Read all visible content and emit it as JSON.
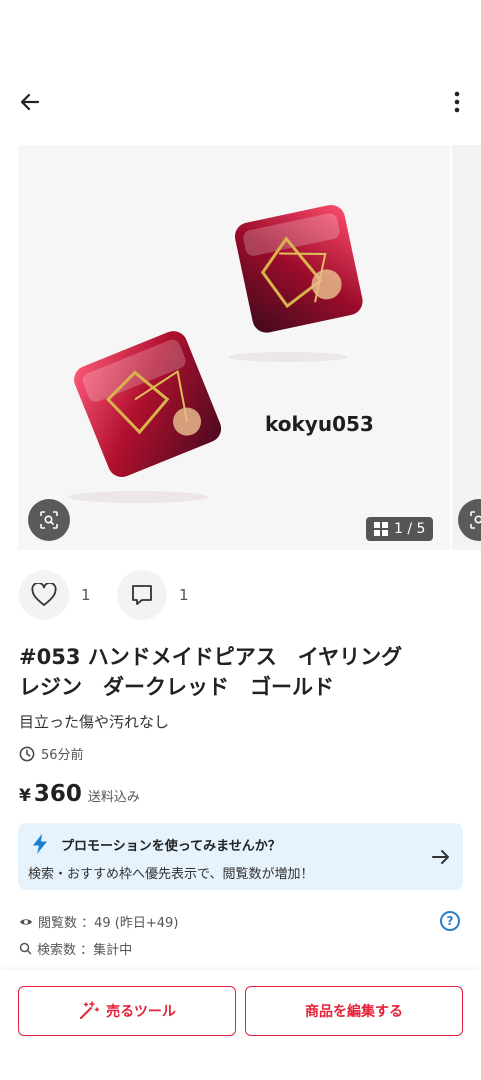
{
  "photo": {
    "watermark": "kokyu053",
    "counter": "1 / 5"
  },
  "social": {
    "likes": "1",
    "comments": "1"
  },
  "item": {
    "title": "#053 ハンドメイドピアス　イヤリング\nレジン　ダークレッド　ゴールド",
    "condition": "目立った傷や汚れなし",
    "posted": "56分前",
    "yen_symbol": "¥",
    "price": "360",
    "shipping": "送料込み"
  },
  "promo": {
    "title": "プロモーションを使ってみませんか？",
    "subtitle": "検索・おすすめ枠へ優先表示で、閲覧数が増加！"
  },
  "stats": {
    "views": "閲覧数 ：49 (昨日+49)",
    "searches": "検索数 ：集計中"
  },
  "actions": {
    "sell_tool": "売るツール",
    "edit_item": "商品を編集する"
  },
  "colors": {
    "accent": "#e5223a",
    "promo_bg": "#e6f2fc",
    "help": "#2a7fc9"
  }
}
